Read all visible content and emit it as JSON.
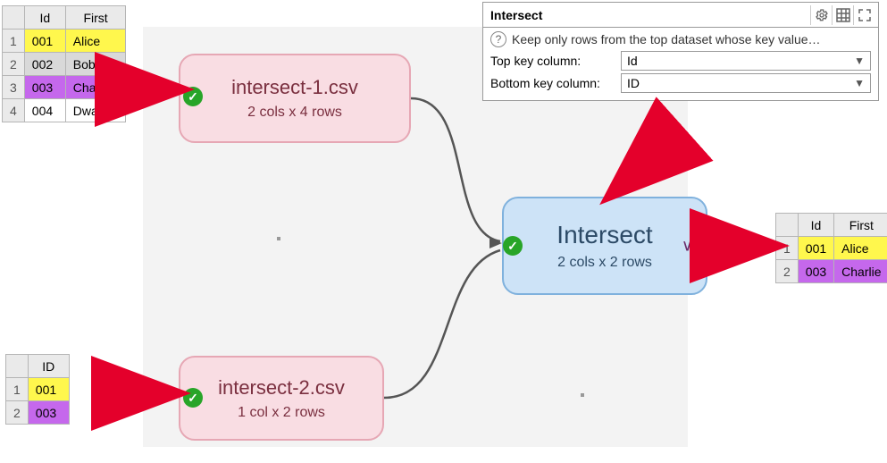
{
  "input_top": {
    "headers": [
      "Id",
      "First"
    ],
    "rows": [
      {
        "n": "1",
        "id": "001",
        "first": "Alice",
        "id_class": "cell-yellow",
        "first_class": "cell-yellow"
      },
      {
        "n": "2",
        "id": "002",
        "first": "Bob",
        "id_class": "cell-grey",
        "first_class": "cell-grey"
      },
      {
        "n": "3",
        "id": "003",
        "first": "Charlie",
        "id_class": "cell-purple",
        "first_class": "cell-purple"
      },
      {
        "n": "4",
        "id": "004",
        "first": "Dwayne",
        "id_class": "",
        "first_class": ""
      }
    ]
  },
  "input_bottom": {
    "headers": [
      "ID"
    ],
    "rows": [
      {
        "n": "1",
        "id": "001",
        "id_class": "cell-yellow"
      },
      {
        "n": "2",
        "id": "003",
        "id_class": "cell-purple"
      }
    ]
  },
  "output": {
    "headers": [
      "Id",
      "First"
    ],
    "rows": [
      {
        "n": "1",
        "id": "001",
        "first": "Alice",
        "id_class": "cell-yellow",
        "first_class": "cell-yellow"
      },
      {
        "n": "2",
        "id": "003",
        "first": "Charlie",
        "id_class": "cell-purple",
        "first_class": "cell-purple"
      }
    ]
  },
  "nodes": {
    "n1": {
      "title": "intersect-1.csv",
      "sub": "2 cols x 4 rows"
    },
    "n2": {
      "title": "intersect-2.csv",
      "sub": "1 col x 2 rows"
    },
    "n3": {
      "title": "Intersect",
      "sub": "2 cols x 2 rows"
    }
  },
  "panel": {
    "title": "Intersect",
    "desc": "Keep only rows from the top dataset whose key value…",
    "row1_label": "Top key column:",
    "row1_value": "Id",
    "row2_label": "Bottom key column:",
    "row2_value": "ID"
  }
}
